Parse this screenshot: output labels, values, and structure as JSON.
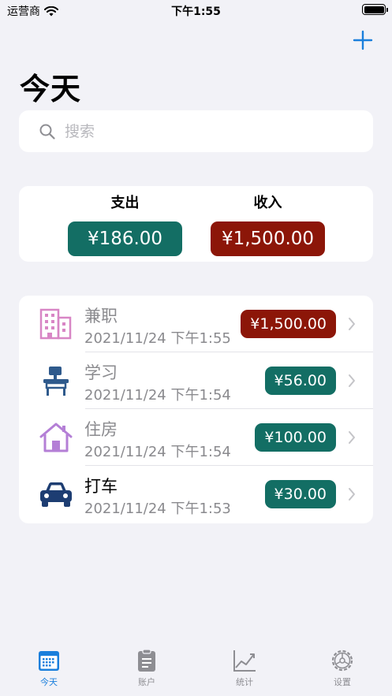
{
  "status_bar": {
    "carrier": "运营商",
    "time": "下午1:55"
  },
  "header": {
    "title": "今天"
  },
  "search": {
    "placeholder": "搜索",
    "value": ""
  },
  "summary": {
    "expense_label": "支出",
    "expense_amount": "¥186.00",
    "income_label": "收入",
    "income_amount": "¥1,500.00"
  },
  "transactions": [
    {
      "name": "兼职",
      "date": "2021/11/24 下午1:55",
      "amount": "¥1,500.00",
      "type": "income",
      "icon": "building-icon"
    },
    {
      "name": "学习",
      "date": "2021/11/24 下午1:54",
      "amount": "¥56.00",
      "type": "expense",
      "icon": "school-desk-icon"
    },
    {
      "name": "住房",
      "date": "2021/11/24 下午1:54",
      "amount": "¥100.00",
      "type": "expense",
      "icon": "house-icon"
    },
    {
      "name": "打车",
      "date": "2021/11/24 下午1:53",
      "amount": "¥30.00",
      "type": "expense",
      "icon": "car-icon"
    }
  ],
  "tabs": [
    {
      "label": "今天",
      "icon": "calendar-icon",
      "active": true
    },
    {
      "label": "账户",
      "icon": "clipboard-icon",
      "active": false
    },
    {
      "label": "统计",
      "icon": "chart-icon",
      "active": false
    },
    {
      "label": "设置",
      "icon": "gear-icon",
      "active": false
    }
  ],
  "colors": {
    "expense": "#136e64",
    "income": "#8c1608",
    "accent": "#1a7fdc",
    "building_icon": "#d886c5",
    "desk_icon": "#2f5a8c",
    "house_icon": "#b47fd6",
    "car_icon": "#1d3d72"
  }
}
